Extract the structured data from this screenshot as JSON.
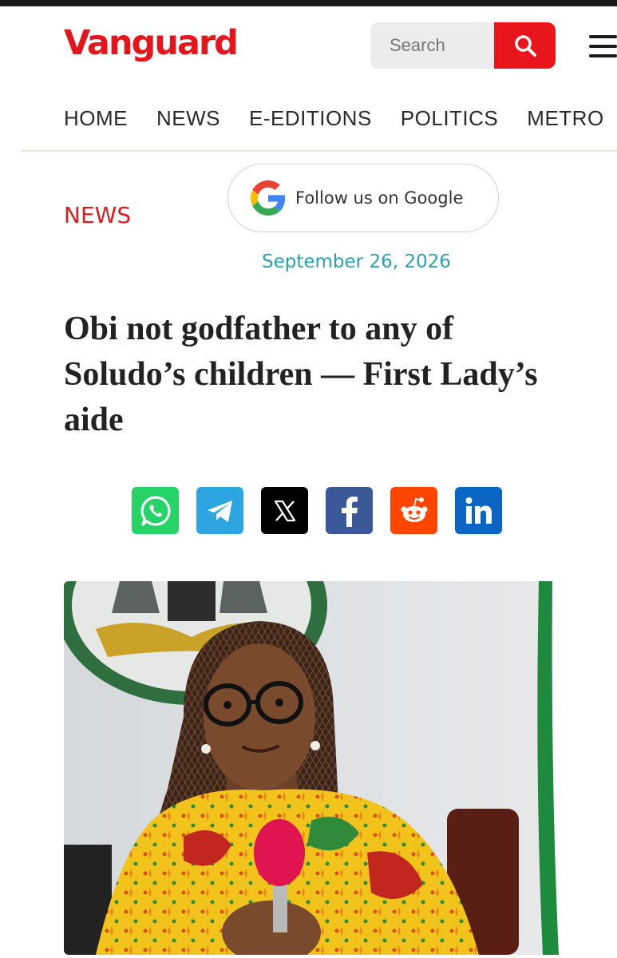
{
  "header": {
    "logo_text": "Vanguard",
    "search_placeholder": "Search",
    "brand_color": "#e4161b"
  },
  "nav": {
    "items": [
      {
        "label": "HOME"
      },
      {
        "label": "NEWS"
      },
      {
        "label": "E-EDITIONS"
      },
      {
        "label": "POLITICS"
      },
      {
        "label": "METRO"
      }
    ]
  },
  "article": {
    "category": "NEWS",
    "follow_label": "Follow us on Google",
    "date": "September 26, 2026",
    "headline": "Obi not godfather to any of Soludo’s children — First Lady’s aide"
  },
  "share": {
    "buttons": [
      {
        "icon": "whatsapp-icon",
        "color": "#25d366"
      },
      {
        "icon": "telegram-icon",
        "color": "#2ca5e0"
      },
      {
        "icon": "x-icon",
        "color": "#000000"
      },
      {
        "icon": "facebook-icon",
        "color": "#3b5998"
      },
      {
        "icon": "reddit-icon",
        "color": "#ff4500"
      },
      {
        "icon": "linkedin-icon",
        "color": "#0a66c2"
      }
    ]
  }
}
